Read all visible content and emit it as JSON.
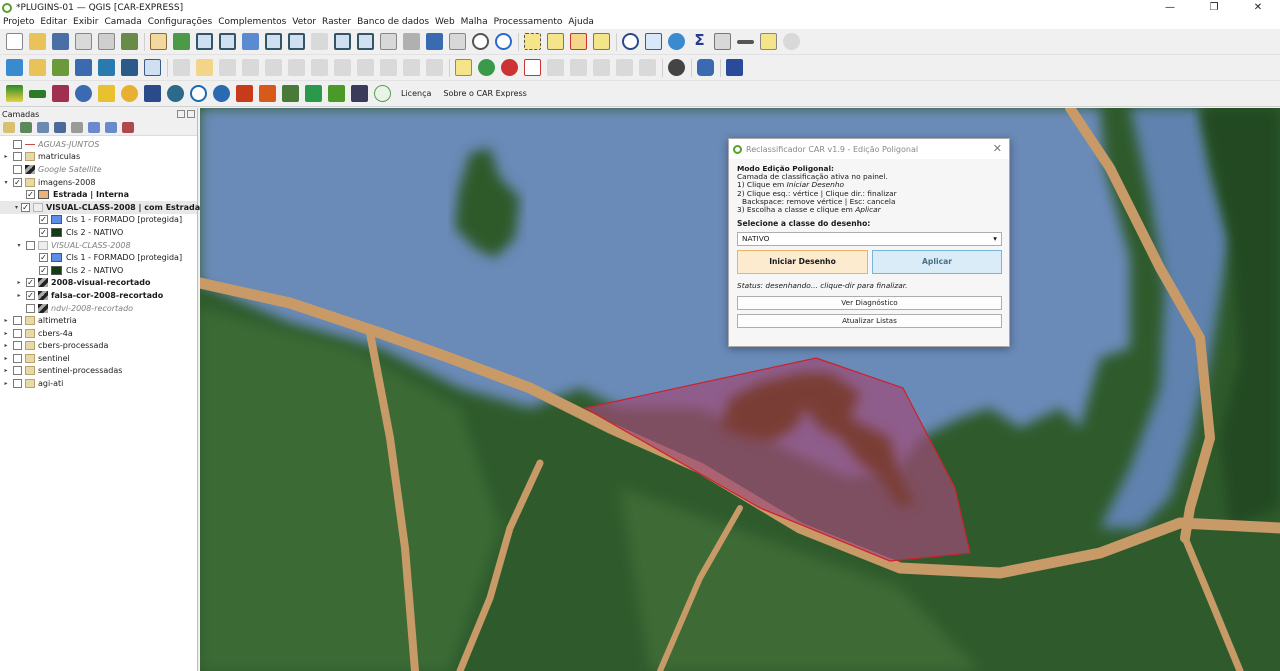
{
  "window": {
    "title": "*PLUGINS-01 — QGIS [CAR-EXPRESS]"
  },
  "menu": [
    "Projeto",
    "Editar",
    "Exibir",
    "Camada",
    "Configurações",
    "Complementos",
    "Vetor",
    "Raster",
    "Banco de dados",
    "Web",
    "Malha",
    "Processamento",
    "Ajuda"
  ],
  "toolbar3_links": {
    "license": "Licença",
    "about": "Sobre o CAR Express"
  },
  "layers_panel": {
    "title": "Camadas",
    "items": [
      {
        "label": "AGUAS-JUNTOS",
        "type": "vector-line",
        "style": "ital",
        "indent": 0,
        "arrow": "",
        "checked": false
      },
      {
        "label": "matriculas",
        "type": "group",
        "style": "",
        "indent": 0,
        "arrow": "▸",
        "checked": false
      },
      {
        "label": "Google Satellite",
        "type": "raster",
        "style": "ital",
        "indent": 0,
        "arrow": "",
        "checked": false
      },
      {
        "label": "imagens-2008",
        "type": "group",
        "style": "",
        "indent": 0,
        "arrow": "▾",
        "checked": true
      },
      {
        "label": "Estrada | Interna",
        "type": "swatch",
        "color": "#e8b478",
        "style": "bold",
        "indent": 1,
        "arrow": "",
        "checked": true
      },
      {
        "label": "VISUAL-CLASS-2008 | com Estradas",
        "type": "group-gray",
        "style": "bold sel",
        "indent": 1,
        "arrow": "▾",
        "checked": true
      },
      {
        "label": "Cls 1 - FORMADO [protegida]",
        "type": "swatch",
        "color": "#5b8ee6",
        "style": "",
        "indent": 2,
        "arrow": "",
        "checked": true
      },
      {
        "label": "Cls 2 - NATIVO",
        "type": "swatch",
        "color": "#123d14",
        "style": "",
        "indent": 2,
        "arrow": "",
        "checked": true
      },
      {
        "label": "VISUAL-CLASS-2008",
        "type": "group-gray",
        "style": "ital",
        "indent": 1,
        "arrow": "▾",
        "checked": false
      },
      {
        "label": "Cls 1 - FORMADO [protegida]",
        "type": "swatch",
        "color": "#5b8ee6",
        "style": "",
        "indent": 2,
        "arrow": "",
        "checked": true
      },
      {
        "label": "Cls 2 - NATIVO",
        "type": "swatch",
        "color": "#123d14",
        "style": "",
        "indent": 2,
        "arrow": "",
        "checked": true
      },
      {
        "label": "2008-visual-recortado",
        "type": "raster",
        "style": "bold",
        "indent": 1,
        "arrow": "▸",
        "checked": true
      },
      {
        "label": "falsa-cor-2008-recortado",
        "type": "raster",
        "style": "bold",
        "indent": 1,
        "arrow": "▸",
        "checked": true
      },
      {
        "label": "ndvi-2008-recortado",
        "type": "raster",
        "style": "ital",
        "indent": 1,
        "arrow": "",
        "checked": false
      },
      {
        "label": "altimetria",
        "type": "group",
        "style": "",
        "indent": 0,
        "arrow": "▸",
        "checked": false
      },
      {
        "label": "cbers-4a",
        "type": "group",
        "style": "",
        "indent": 0,
        "arrow": "▸",
        "checked": false
      },
      {
        "label": "cbers-processada",
        "type": "group",
        "style": "",
        "indent": 0,
        "arrow": "▸",
        "checked": false
      },
      {
        "label": "sentinel",
        "type": "group",
        "style": "",
        "indent": 0,
        "arrow": "▸",
        "checked": false
      },
      {
        "label": "sentinel-processadas",
        "type": "group",
        "style": "",
        "indent": 0,
        "arrow": "▸",
        "checked": false
      },
      {
        "label": "agi-ati",
        "type": "group",
        "style": "",
        "indent": 0,
        "arrow": "▸",
        "checked": false
      }
    ]
  },
  "dialog": {
    "title": "Reclassificador CAR v1.9 - Edição Poligonal",
    "heading": "Modo Edição Poligonal:",
    "line1": "Camada de classificação ativa no painel.",
    "line2_pre": "1) Clique em ",
    "line2_em": "Iniciar Desenho",
    "line3": "2) Clique esq.: vértice | Clique dir.: finalizar",
    "line4": "Backspace: remove vértice | Esc: cancela",
    "line5_pre": "3) Escolha a classe e clique em ",
    "line5_em": "Aplicar",
    "class_label": "Selecione a classe do desenho:",
    "class_value": "NATIVO",
    "start_button": "Iniciar Desenho",
    "apply_button": "Aplicar",
    "status": "Status: desenhando... clique-dir para finalizar.",
    "diagnostic_button": "Ver Diagnóstico",
    "refresh_button": "Atualizar Listas"
  },
  "colors": {
    "water": "#6a8ab8",
    "forest": "#2f5b2c",
    "road": "#c79a68",
    "polygon_fill": "#a04a78",
    "polygon_stroke": "#d0202a"
  }
}
